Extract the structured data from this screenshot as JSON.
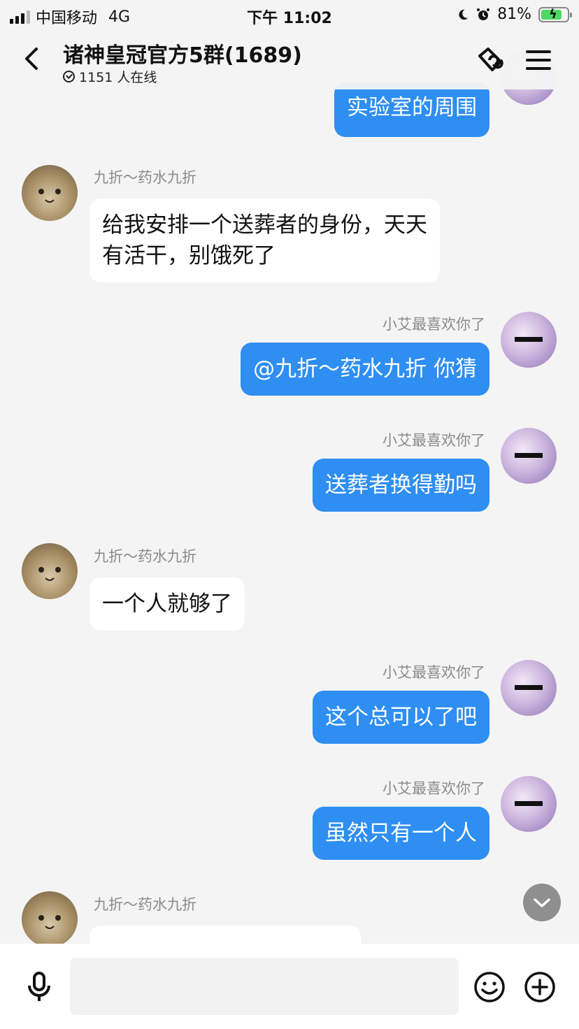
{
  "status_bar": {
    "carrier": "中国移动",
    "network": "4G",
    "time": "下午 11:02",
    "battery": "81%",
    "battery_level": 0.81
  },
  "header": {
    "title": "诸神皇冠官方5群(1689)",
    "online": "1151 人在线"
  },
  "messages": [
    {
      "id": "m0",
      "direction": "out",
      "sender": "",
      "text": "实验室的周围"
    },
    {
      "id": "m1",
      "direction": "in",
      "sender": "九折～药水九折",
      "lines": [
        "给我安排一个送葬者的身份，天天",
        "有活干，别饿死了"
      ]
    },
    {
      "id": "m2",
      "direction": "out",
      "sender": "小艾最喜欢你了",
      "text": "@九折～药水九折 你猜"
    },
    {
      "id": "m3",
      "direction": "out",
      "sender": "小艾最喜欢你了",
      "text": "送葬者换得勤吗"
    },
    {
      "id": "m4",
      "direction": "in",
      "sender": "九折～药水九折",
      "text": "一个人就够了"
    },
    {
      "id": "m5",
      "direction": "out",
      "sender": "小艾最喜欢你了",
      "text": "这个总可以了吧"
    },
    {
      "id": "m6",
      "direction": "out",
      "sender": "小艾最喜欢你了",
      "text": "虽然只有一个人"
    },
    {
      "id": "m7",
      "direction": "in",
      "sender": "九折～药水九折",
      "text": ""
    }
  ],
  "input": {
    "placeholder": "",
    "value": ""
  },
  "icons": {
    "back": "back-arrow-icon",
    "call": "group-call-icon",
    "menu": "menu-icon",
    "voice": "microphone-icon",
    "emoji": "emoji-icon",
    "more": "plus-icon",
    "scroll": "chevron-down-icon"
  },
  "colors": {
    "outgoing_bubble": "#2e8ef2",
    "incoming_bubble": "#ffffff",
    "background": "#f4f4f4"
  }
}
